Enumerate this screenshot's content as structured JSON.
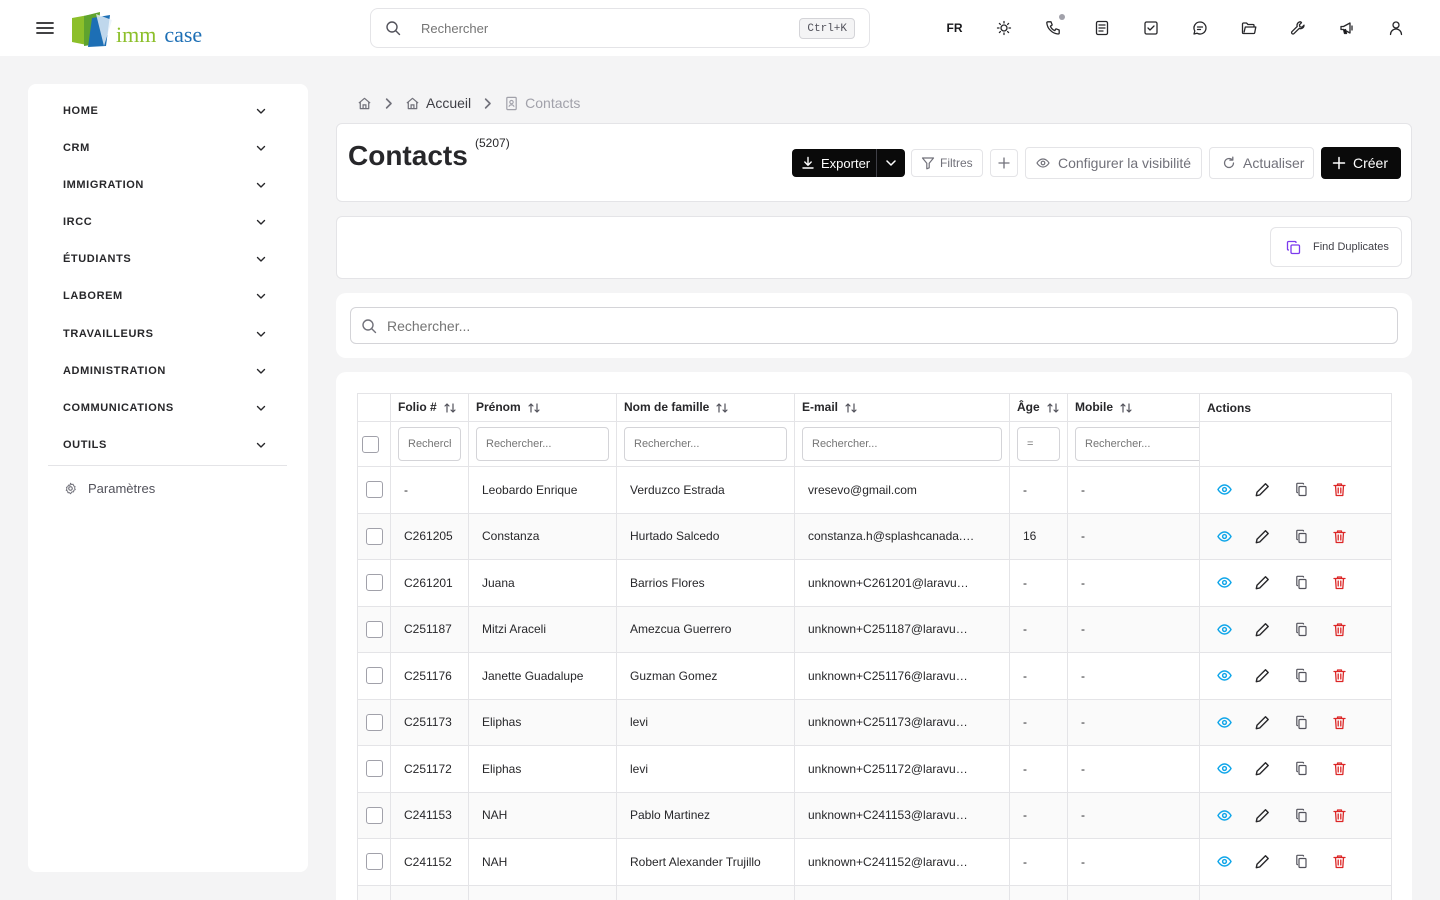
{
  "topbar": {
    "logo_word_1": "imm",
    "logo_word_2": "case",
    "search_placeholder": "Rechercher",
    "search_shortcut": "Ctrl+K",
    "language": "FR",
    "icons": [
      "sun-icon",
      "phone-icon",
      "notes-icon",
      "tasks-icon",
      "chat-icon",
      "folder-icon",
      "tools-icon",
      "megaphone-icon",
      "user-icon"
    ]
  },
  "sidebar": {
    "items": [
      {
        "label": "HOME"
      },
      {
        "label": "CRM"
      },
      {
        "label": "IMMIGRATION"
      },
      {
        "label": "IRCC"
      },
      {
        "label": "ÉTUDIANTS"
      },
      {
        "label": "LABOREM"
      },
      {
        "label": "TRAVAILLEURS"
      },
      {
        "label": "ADMINISTRATION"
      },
      {
        "label": "COMMUNICATIONS"
      },
      {
        "label": "OUTILS"
      }
    ],
    "settings_label": "Paramètres"
  },
  "breadcrumb": {
    "home": "Accueil",
    "current": "Contacts"
  },
  "header": {
    "title": "Contacts",
    "count": "(5207)",
    "export_label": "Exporter",
    "filter_label": "Filtres",
    "visibility_label": "Configurer la visibilité",
    "refresh_label": "Actualiser",
    "create_label": "Créer"
  },
  "duplicates": {
    "label": "Find Duplicates"
  },
  "table_search": {
    "placeholder": "Rechercher..."
  },
  "table": {
    "columns": [
      "Folio #",
      "Prénom",
      "Nom de famille",
      "E-mail",
      "Âge",
      "Mobile",
      "Actions"
    ],
    "filter_placeholders": {
      "folio": "Rechercher...",
      "first": "Rechercher...",
      "last": "Rechercher...",
      "email": "Rechercher...",
      "age": "=",
      "mobile": "Rechercher..."
    },
    "rows": [
      {
        "folio": "-",
        "first": "Leobardo Enrique",
        "last": "Verduzco Estrada",
        "email": "vresevo@gmail.com",
        "age": "-",
        "mobile": "-"
      },
      {
        "folio": "C261205",
        "first": "Constanza",
        "last": "Hurtado Salcedo",
        "email": "constanza.h@splashcanada.…",
        "age": "16",
        "mobile": "-"
      },
      {
        "folio": "C261201",
        "first": "Juana",
        "last": "Barrios Flores",
        "email": "unknown+C261201@laravu…",
        "age": "-",
        "mobile": "-"
      },
      {
        "folio": "C251187",
        "first": "Mitzi Araceli",
        "last": "Amezcua Guerrero",
        "email": "unknown+C251187@laravu…",
        "age": "-",
        "mobile": "-"
      },
      {
        "folio": "C251176",
        "first": "Janette Guadalupe",
        "last": "Guzman Gomez",
        "email": "unknown+C251176@laravu…",
        "age": "-",
        "mobile": "-"
      },
      {
        "folio": "C251173",
        "first": "Eliphas",
        "last": "levi",
        "email": "unknown+C251173@laravu…",
        "age": "-",
        "mobile": "-"
      },
      {
        "folio": "C251172",
        "first": "Eliphas",
        "last": "levi",
        "email": "unknown+C251172@laravu…",
        "age": "-",
        "mobile": "-"
      },
      {
        "folio": "C241153",
        "first": "NAH",
        "last": "Pablo Martinez",
        "email": "unknown+C241153@laravu…",
        "age": "-",
        "mobile": "-"
      },
      {
        "folio": "C241152",
        "first": "NAH",
        "last": "Robert Alexander Trujillo",
        "email": "unknown+C241152@laravu…",
        "age": "-",
        "mobile": "-"
      },
      {
        "folio": "",
        "first": "",
        "last": "",
        "email": "",
        "age": "",
        "mobile": ""
      }
    ]
  },
  "colors": {
    "view_icon": "#0ea5e9",
    "delete_icon": "#dc2626",
    "primary_button": "#0a0a0a",
    "duplicates_icon": "#7c3aed"
  }
}
